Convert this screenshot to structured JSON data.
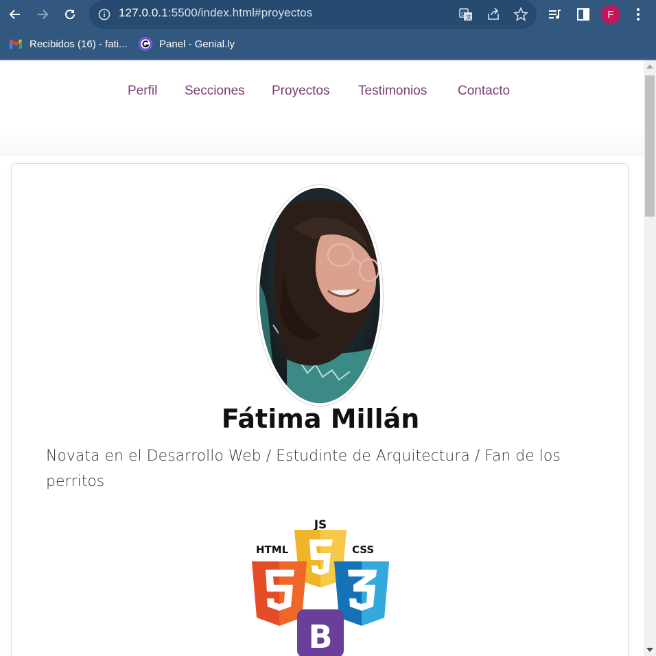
{
  "browser": {
    "url_host": "127.0.0.1",
    "url_rest": ":5500/index.html#proyectos",
    "profile_initial": "F",
    "bookmarks": [
      {
        "label": "Recibidos (16) - fati...",
        "icon": "gmail-icon"
      },
      {
        "label": "Panel - Genial.ly",
        "icon": "genially-icon"
      }
    ]
  },
  "nav": {
    "links": [
      "Perfil",
      "Secciones",
      "Proyectos",
      "Testimonios",
      "Contacto"
    ]
  },
  "profile": {
    "name": "Fátima Millán",
    "bio": "Novata en el Desarrollo Web / Estudinte de Arquitectura / Fan de los perritos"
  },
  "logos": {
    "js": "JS",
    "html": "HTML",
    "css": "CSS",
    "bootstrap": "B"
  },
  "colors": {
    "chrome": "#33587f",
    "nav_link": "#7a3a73",
    "avatar": "#c2185b"
  }
}
